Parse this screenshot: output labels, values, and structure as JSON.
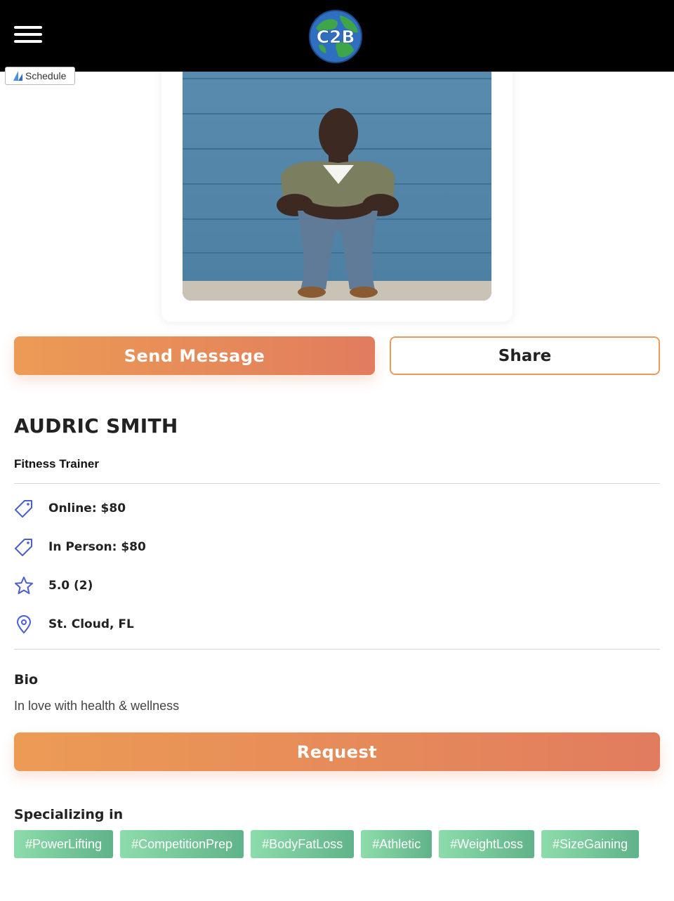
{
  "header": {
    "logo_text": "C2B",
    "schedule_label": "Schedule"
  },
  "actions": {
    "send_message": "Send Message",
    "share": "Share",
    "request": "Request"
  },
  "profile": {
    "name": "AUDRIC SMITH",
    "role": "Fitness Trainer",
    "online_price": "Online: $80",
    "in_person_price": "In Person: $80",
    "rating": "5.0 (2)",
    "location": "St. Cloud, FL"
  },
  "bio": {
    "heading": "Bio",
    "text": "In love with health & wellness"
  },
  "specializing": {
    "heading": "Specializing in",
    "tags": [
      "#PowerLifting",
      "#CompetitionPrep",
      "#BodyFatLoss",
      "#Athletic",
      "#WeightLoss",
      "#SizeGaining"
    ]
  },
  "colors": {
    "accent_orange": "#ec9b55",
    "accent_orange_end": "#e17c5e",
    "icon_blue": "#4a5fd0",
    "tag_green": "#7acb9c"
  },
  "icons": {
    "menu": "hamburger-icon",
    "price": "price-tag-icon",
    "rating": "star-icon",
    "location": "location-pin-icon"
  }
}
